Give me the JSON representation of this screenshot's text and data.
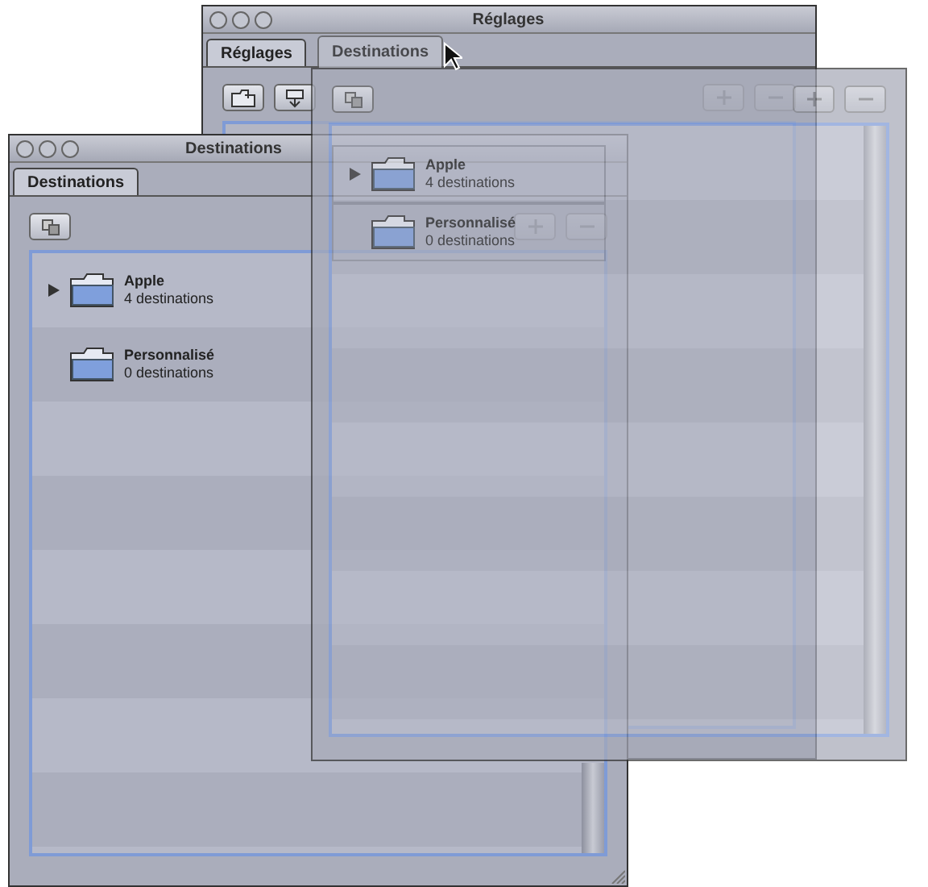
{
  "back_window": {
    "title": "Réglages",
    "tabs": [
      {
        "label": "Réglages",
        "selected": true
      }
    ]
  },
  "front_window": {
    "title": "Destinations",
    "tabs": [
      {
        "label": "Destinations",
        "selected": true
      }
    ],
    "rows": [
      {
        "name": "Apple",
        "count": "4 destinations",
        "expandable": true
      },
      {
        "name": "Personnalisé",
        "count": "0 destinations",
        "expandable": false
      }
    ]
  },
  "dragged_window": {
    "tab": "Destinations",
    "rows": [
      {
        "name": "Apple",
        "count": "4 destinations",
        "expandable": true
      },
      {
        "name": "Personnalisé",
        "count": "0 destinations",
        "expandable": false
      }
    ]
  }
}
